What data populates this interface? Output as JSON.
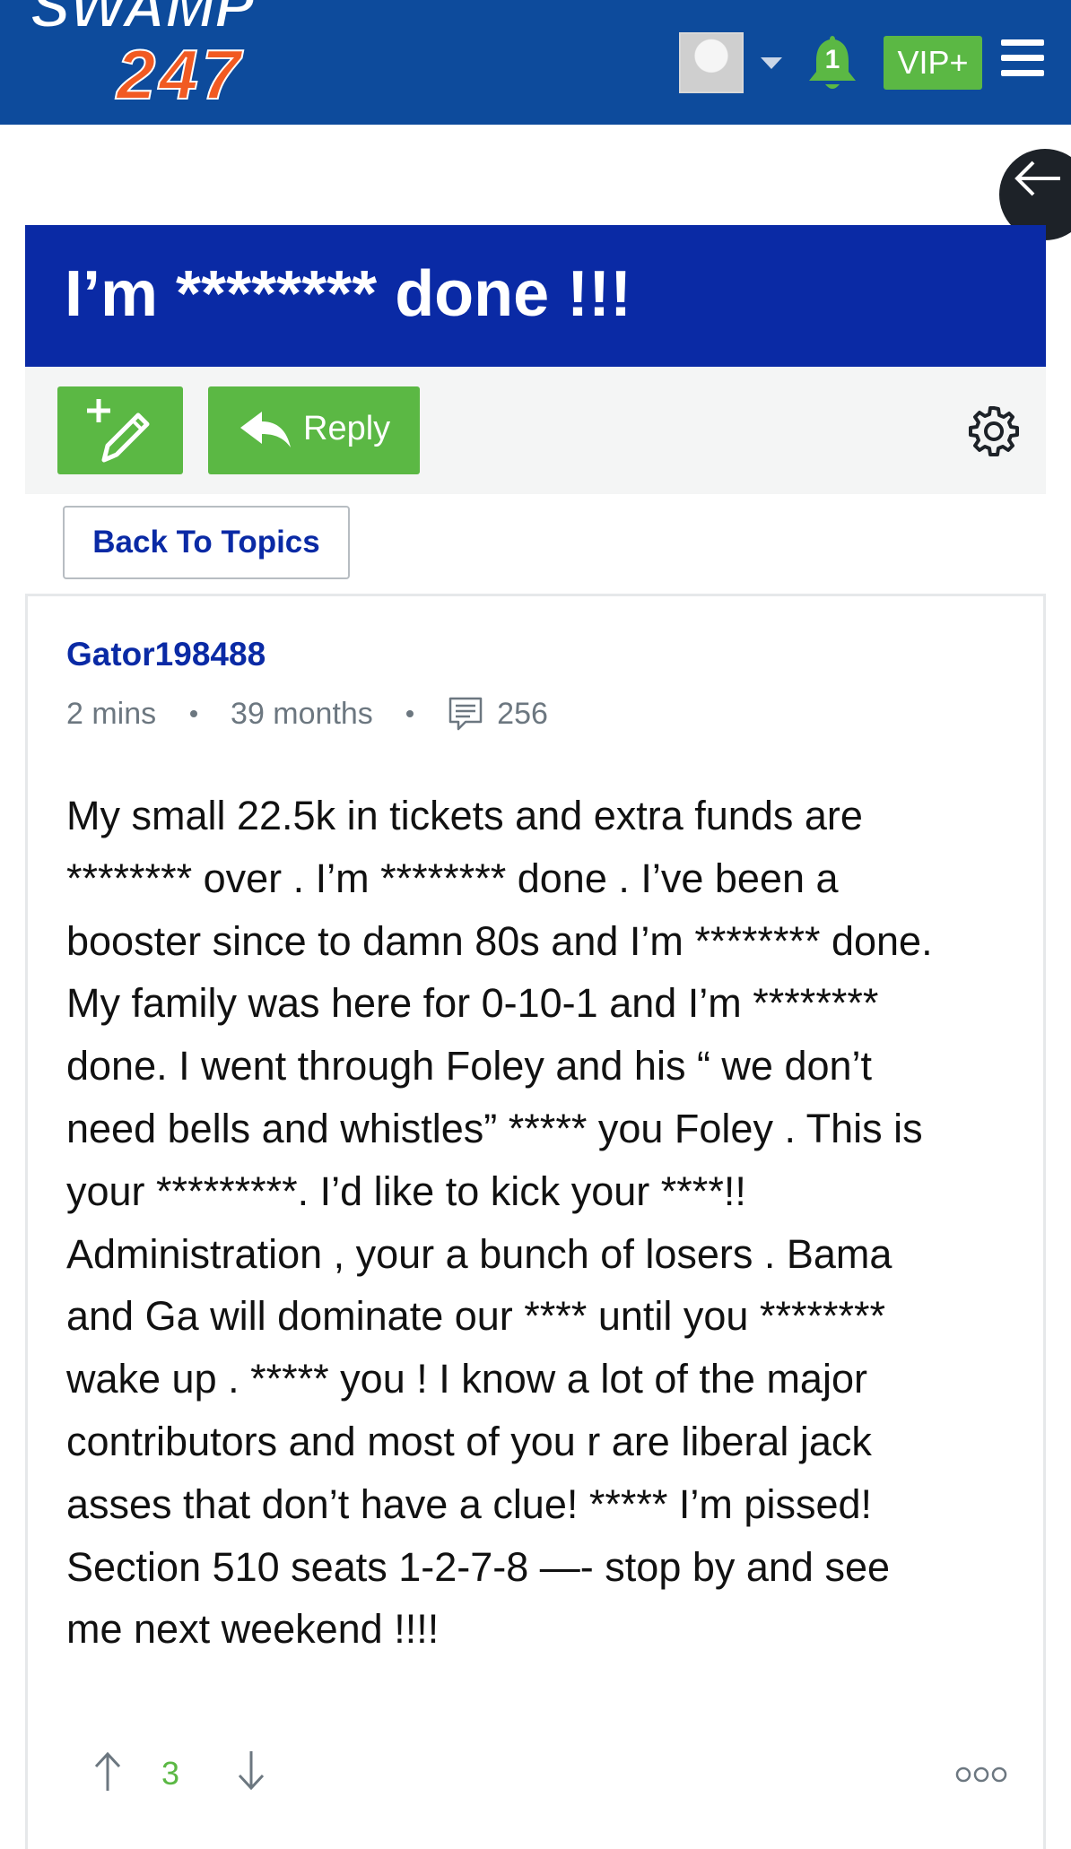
{
  "header": {
    "logo_top": "SWAMP",
    "logo_bottom": "247",
    "notification_count": "1",
    "vip_label": "VIP+",
    "brand_color": "#0d4b9c",
    "accent_color": "#5bb844",
    "logo_orange": "#f15a22"
  },
  "thread": {
    "title": "I’m ******** done !!!",
    "title_bg": "#0a2aa5"
  },
  "toolbar": {
    "new_topic_icon": "pencil-plus-icon",
    "reply_label": "Reply",
    "settings_icon": "gear-icon"
  },
  "nav": {
    "back_to_topics_label": "Back To Topics"
  },
  "post": {
    "author": "Gator198488",
    "time_ago": "2 mins",
    "member_for": "39 months",
    "post_count": "256",
    "body_lines": [
      "My small 22.5k in tickets and extra funds are",
      "******** over . I’m ******** done . I’ve been a",
      "booster since to damn 80s and I’m ******** done.",
      "My family was here for 0-10-1 and I’m ********",
      "done. I went through Foley and his “ we don’t",
      "need bells and whistles” ***** you Foley . This is",
      "your *********. I’d like to kick your ****!!",
      "Administration , your a bunch of losers . Bama",
      "and Ga will dominate our **** until you ********",
      "wake up . ***** you ! I know a lot of the major",
      "contributors and most of you r are liberal jack",
      "asses that don’t have a clue! ***** I’m pissed!",
      "Section 510 seats 1-2-7-8 —- stop by and see",
      "me next weekend !!!!"
    ],
    "vote_score": "3"
  }
}
